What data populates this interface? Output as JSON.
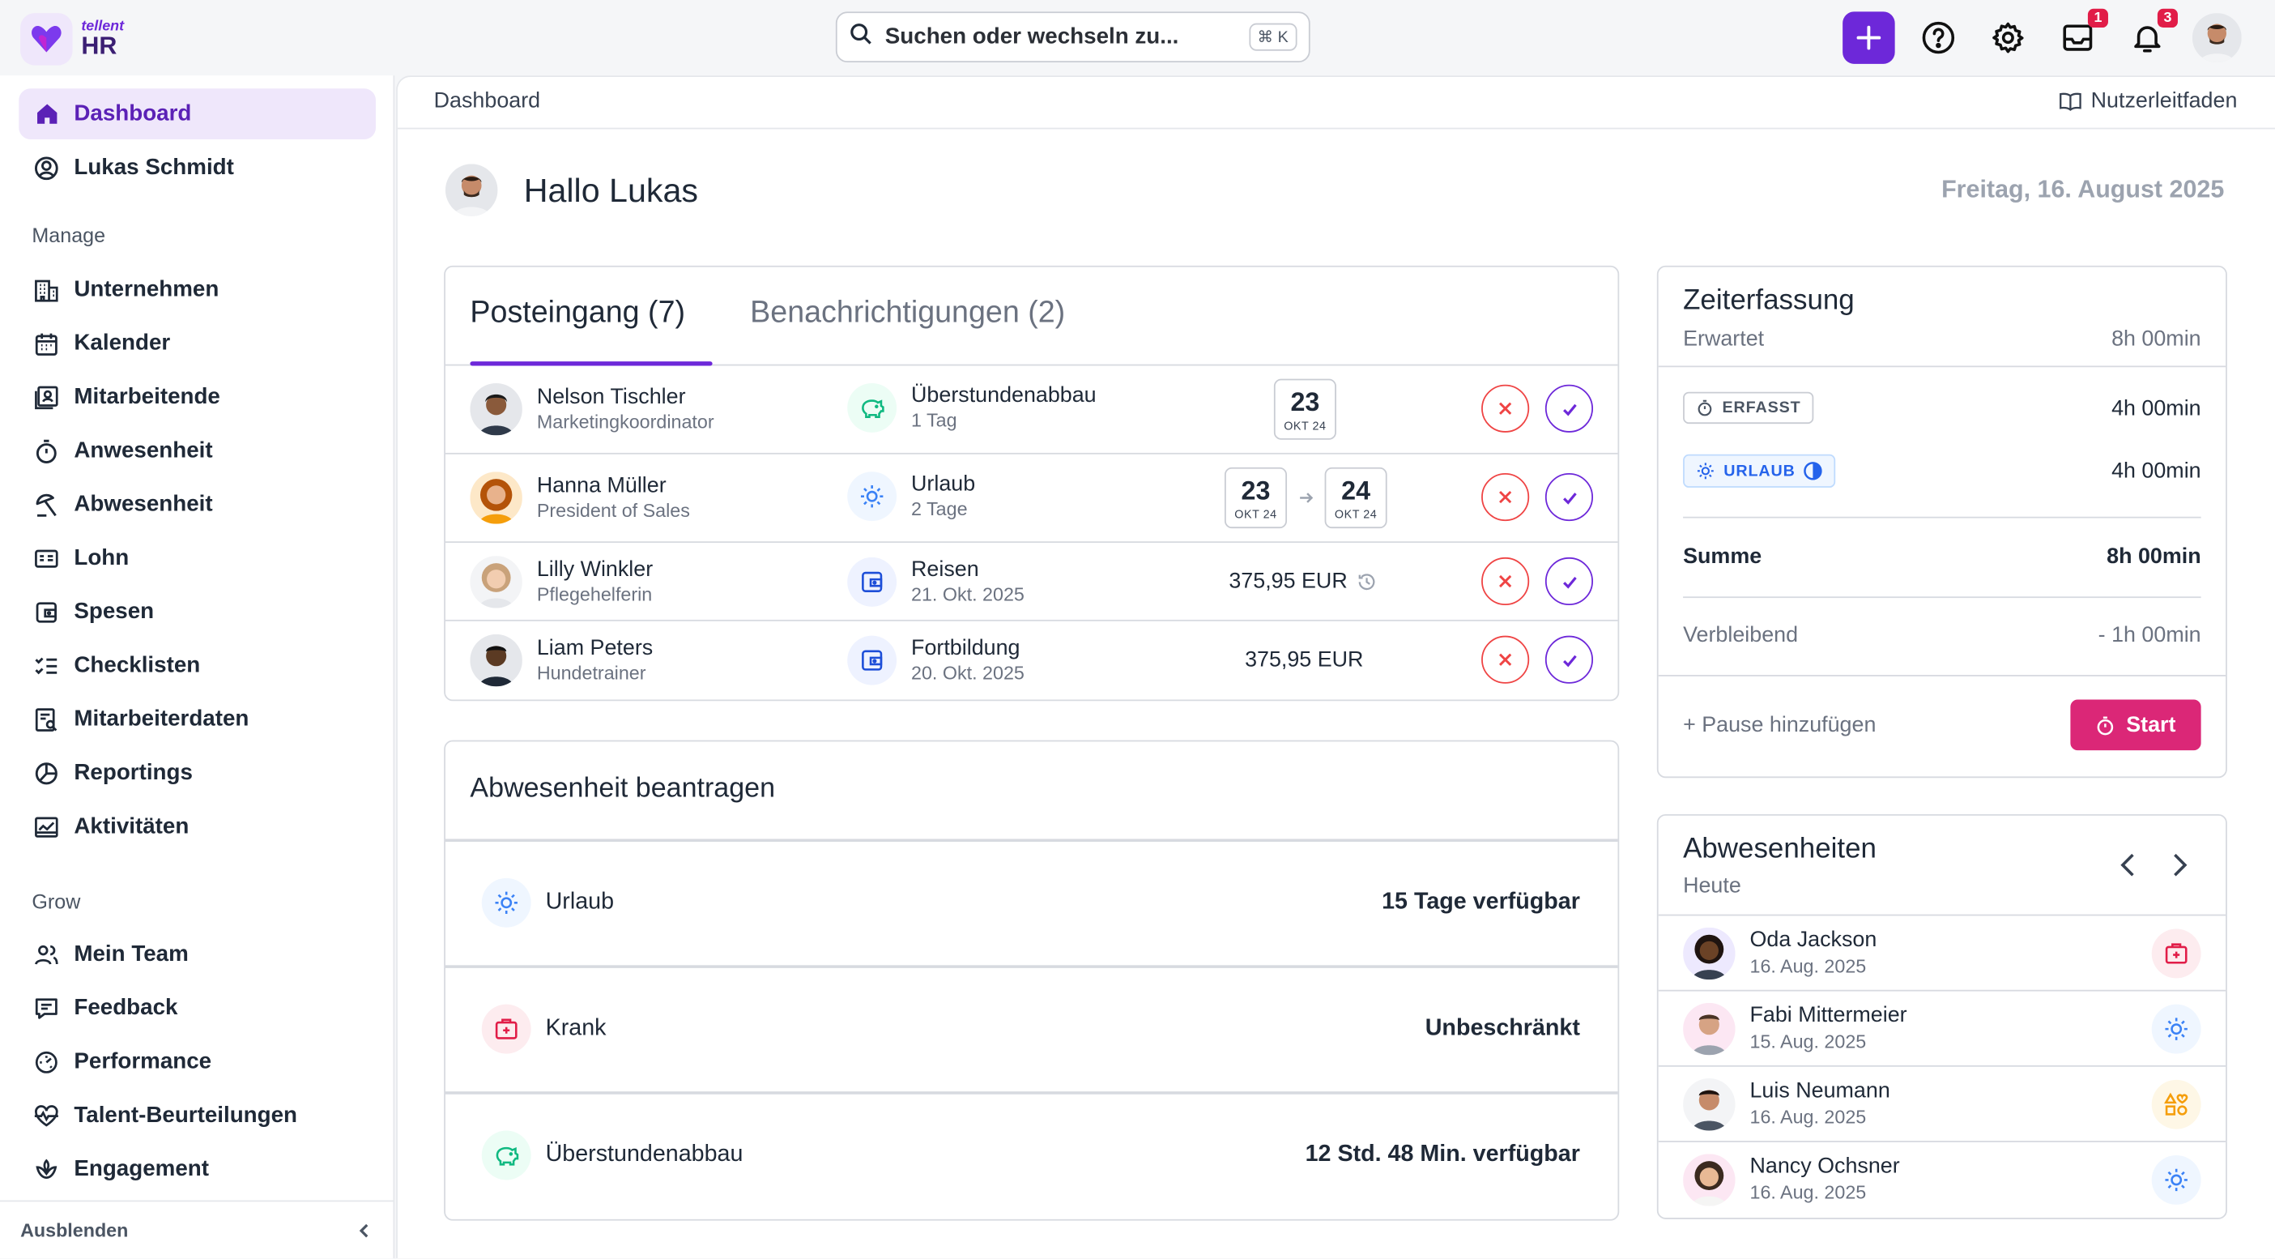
{
  "app": {
    "brand_small": "tellent",
    "brand_large": "HR"
  },
  "search": {
    "placeholder": "Suchen oder wechseln zu...",
    "shortcut": "⌘ K"
  },
  "topbar": {
    "inbox_badge": "1",
    "notifications_badge": "3"
  },
  "sidebar": {
    "items": [
      {
        "label": "Dashboard",
        "icon": "home-icon",
        "active": true
      },
      {
        "label": "Lukas Schmidt",
        "icon": "user-circle-icon"
      }
    ],
    "manage_title": "Manage",
    "manage": [
      {
        "label": "Unternehmen",
        "icon": "building-icon"
      },
      {
        "label": "Kalender",
        "icon": "calendar-icon"
      },
      {
        "label": "Mitarbeitende",
        "icon": "employee-icon"
      },
      {
        "label": "Anwesenheit",
        "icon": "stopwatch-icon"
      },
      {
        "label": "Abwesenheit",
        "icon": "beach-umbrella-icon"
      },
      {
        "label": "Lohn",
        "icon": "payroll-icon"
      },
      {
        "label": "Spesen",
        "icon": "wallet-icon"
      },
      {
        "label": "Checklisten",
        "icon": "checklist-icon"
      },
      {
        "label": "Mitarbeiterdaten",
        "icon": "data-sheet-icon"
      },
      {
        "label": "Reportings",
        "icon": "pie-chart-icon"
      },
      {
        "label": "Aktivitäten",
        "icon": "activity-chart-icon"
      }
    ],
    "grow_title": "Grow",
    "grow": [
      {
        "label": "Mein Team",
        "icon": "team-icon"
      },
      {
        "label": "Feedback",
        "icon": "feedback-icon"
      },
      {
        "label": "Performance",
        "icon": "gauge-icon"
      },
      {
        "label": "Talent-Beurteilungen",
        "icon": "heart-pulse-icon"
      },
      {
        "label": "Engagement",
        "icon": "engagement-icon"
      }
    ],
    "footer_label": "Ausblenden"
  },
  "header": {
    "breadcrumb": "Dashboard",
    "guide": "Nutzerleitfaden"
  },
  "greeting": {
    "text": "Hallo Lukas",
    "date": "Freitag, 16. August 2025"
  },
  "inbox": {
    "tab_inbox": "Posteingang (7)",
    "tab_notifications": "Benachrichtigungen (2)",
    "rows": [
      {
        "name": "Nelson Tischler",
        "role": "Marketingkoordinator",
        "type": "Überstundenabbau",
        "detail": "1 Tag",
        "icon": "piggy-bank-icon",
        "from_day": "23",
        "from_month": "OKT 24"
      },
      {
        "name": "Hanna Müller",
        "role": "President of Sales",
        "type": "Urlaub",
        "detail": "2 Tage",
        "icon": "sun-icon",
        "from_day": "23",
        "from_month": "OKT 24",
        "to_day": "24",
        "to_month": "OKT 24"
      },
      {
        "name": "Lilly Winkler",
        "role": "Pflegehelferin",
        "type": "Reisen",
        "detail": "21. Okt. 2025",
        "icon": "wallet-icon",
        "amount": "375,95 EUR"
      },
      {
        "name": "Liam Peters",
        "role": "Hundetrainer",
        "type": "Fortbildung",
        "detail": "20. Okt. 2025",
        "icon": "wallet-icon",
        "amount": "375,95 EUR"
      }
    ]
  },
  "absence_request": {
    "title": "Abwesenheit beantragen",
    "items": [
      {
        "label": "Urlaub",
        "value": "15 Tage verfügbar",
        "icon": "sun-icon"
      },
      {
        "label": "Krank",
        "value": "Unbeschränkt",
        "icon": "medical-kit-icon"
      },
      {
        "label": "Überstundenabbau",
        "value": "12 Std. 48 Min. verfügbar",
        "icon": "piggy-bank-icon"
      }
    ]
  },
  "time_tracking": {
    "title": "Zeiterfassung",
    "expected_label": "Erwartet",
    "expected_value": "8h 00min",
    "recorded_chip": "ERFASST",
    "recorded_value": "4h 00min",
    "vacation_chip": "URLAUB",
    "vacation_value": "4h 00min",
    "sum_label": "Summe",
    "sum_value": "8h 00min",
    "remaining_label": "Verbleibend",
    "remaining_value": "- 1h 00min",
    "pause_label": "+ Pause hinzufügen",
    "start_label": "Start"
  },
  "absences": {
    "title": "Abwesenheiten",
    "subtitle": "Heute",
    "items": [
      {
        "name": "Oda Jackson",
        "date": "16. Aug. 2025",
        "icon": "medical-kit-icon"
      },
      {
        "name": "Fabi Mittermeier",
        "date": "15. Aug. 2025",
        "icon": "sun-icon"
      },
      {
        "name": "Luis Neumann",
        "date": "16. Aug. 2025",
        "icon": "shapes-icon"
      },
      {
        "name": "Nancy Ochsner",
        "date": "16. Aug. 2025",
        "icon": "sun-icon"
      }
    ]
  },
  "colors": {
    "accent": "#6d28d9",
    "start_button": "#db2777",
    "reject": "#ef4444"
  }
}
